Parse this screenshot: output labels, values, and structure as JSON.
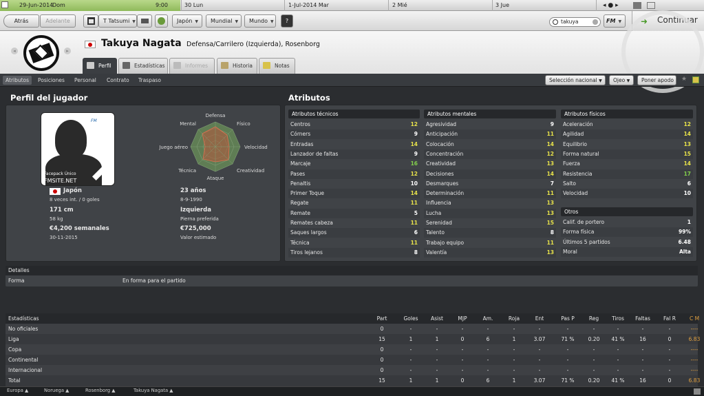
{
  "date_bar": {
    "current_date": "29-Jun-2014",
    "current_day": "Dom",
    "time": "9:00",
    "days": [
      "30 Lun",
      "1-Jul-2014 Mar",
      "2 Mié",
      "3 Jue"
    ]
  },
  "toolbar": {
    "back": "Atrás",
    "forward": "Adelante",
    "manager": "T Tatsumi",
    "nation": "Japón",
    "world": "Mundial",
    "mundo": "Mundo",
    "help": "?",
    "search_value": "takuya",
    "fm_menu": "FM",
    "continue": "Continuar"
  },
  "player": {
    "name": "Takuya Nagata",
    "position_club": "Defensa/Carrilero (Izquierda), Rosenborg",
    "flag_color": "#cc0000"
  },
  "tabs": [
    {
      "label": "Perfil"
    },
    {
      "label": "Estadísticas"
    },
    {
      "label": "Informes"
    },
    {
      "label": "Historia"
    },
    {
      "label": "Notas"
    }
  ],
  "subnav": {
    "items": [
      "Atributos",
      "Posiciones",
      "Personal",
      "Contrato",
      "Traspaso"
    ],
    "national_selection": "Selección nacional",
    "scout": "Ojeo",
    "loan": "Poner apodo"
  },
  "profile": {
    "title": "Perfil del jugador",
    "photo_caption1": "Facepack Único",
    "photo_caption2": "FMSITE.NET",
    "nationality": "Japón",
    "caps": "8 veces int. / 0 goles",
    "age": "23 años",
    "dob": "8-9-1990",
    "height": "171 cm",
    "weight": "58 kg",
    "foot": "Izquierda",
    "foot_label": "Pierna preferida",
    "wage": "€4,200 semanales",
    "contract_end": "30-11-2015",
    "value": "€725,000",
    "value_label": "Valor estimado",
    "radar_labels": {
      "defensa": "Defensa",
      "fisico": "Físico",
      "velocidad": "Velocidad",
      "creatividad": "Creatividad",
      "ataque": "Ataque",
      "tecnica": "Técnica",
      "juego_aereo": "Juego aéreo",
      "mental": "Mental"
    }
  },
  "attributes": {
    "title": "Atributos",
    "technical": {
      "header": "Atributos técnicos",
      "rows": [
        [
          "Centros",
          "12"
        ],
        [
          "Córners",
          "9"
        ],
        [
          "Entradas",
          "14"
        ],
        [
          "Lanzador de faltas",
          "9"
        ],
        [
          "Marcaje",
          "16"
        ],
        [
          "Pases",
          "12"
        ],
        [
          "Penaltis",
          "10"
        ],
        [
          "Primer Toque",
          "14"
        ],
        [
          "Regate",
          "11"
        ],
        [
          "Remate",
          "5"
        ],
        [
          "Remates cabeza",
          "11"
        ],
        [
          "Saques largos",
          "6"
        ],
        [
          "Técnica",
          "11"
        ],
        [
          "Tiros lejanos",
          "8"
        ]
      ]
    },
    "mental": {
      "header": "Atributos mentales",
      "rows": [
        [
          "Agresividad",
          "9"
        ],
        [
          "Anticipación",
          "11"
        ],
        [
          "Colocación",
          "14"
        ],
        [
          "Concentración",
          "12"
        ],
        [
          "Creatividad",
          "13"
        ],
        [
          "Decisiones",
          "14"
        ],
        [
          "Desmarques",
          "7"
        ],
        [
          "Determinación",
          "11"
        ],
        [
          "Influencia",
          "13"
        ],
        [
          "Lucha",
          "13"
        ],
        [
          "Serenidad",
          "15"
        ],
        [
          "Talento",
          "8"
        ],
        [
          "Trabajo equipo",
          "11"
        ],
        [
          "Valentía",
          "13"
        ]
      ]
    },
    "physical": {
      "header": "Atributos físicos",
      "rows": [
        [
          "Aceleración",
          "12"
        ],
        [
          "Agilidad",
          "14"
        ],
        [
          "Equilibrio",
          "13"
        ],
        [
          "Forma natural",
          "15"
        ],
        [
          "Fuerza",
          "14"
        ],
        [
          "Resistencia",
          "17"
        ],
        [
          "Salto",
          "6"
        ],
        [
          "Velocidad",
          "10"
        ]
      ]
    },
    "other": {
      "header": "Otros",
      "rows": [
        [
          "Calif. de portero",
          "1"
        ],
        [
          "Forma física",
          "99%"
        ],
        [
          "Últimos 5 partidos",
          "6.48"
        ],
        [
          "Moral",
          "Alta"
        ]
      ]
    }
  },
  "details": {
    "header": "Detalles",
    "label": "Forma",
    "value": "En forma para el partido"
  },
  "stats": {
    "columns": [
      "Estadísticas",
      "Part",
      "Goles",
      "Asist",
      "MJP",
      "Am.",
      "Roja",
      "Ent",
      "Pas P",
      "Reg",
      "Tiros",
      "Faltas",
      "Fal R",
      "C M"
    ],
    "rows": [
      [
        "No oficiales",
        "0",
        "-",
        "-",
        "-",
        "-",
        "-",
        "-",
        "-",
        "-",
        "-",
        "-",
        "-",
        "----"
      ],
      [
        "Liga",
        "15",
        "1",
        "1",
        "0",
        "6",
        "1",
        "3.07",
        "71 %",
        "0.20",
        "41 %",
        "16",
        "0",
        "6.83"
      ],
      [
        "Copa",
        "0",
        "-",
        "-",
        "-",
        "-",
        "-",
        "-",
        "-",
        "-",
        "-",
        "-",
        "-",
        "----"
      ],
      [
        "Continental",
        "0",
        "-",
        "-",
        "-",
        "-",
        "-",
        "-",
        "-",
        "-",
        "-",
        "-",
        "-",
        "----"
      ],
      [
        "Internacional",
        "0",
        "-",
        "-",
        "-",
        "-",
        "-",
        "-",
        "-",
        "-",
        "-",
        "-",
        "-",
        "----"
      ],
      [
        "Total",
        "15",
        "1",
        "1",
        "0",
        "6",
        "1",
        "3.07",
        "71 %",
        "0.20",
        "41 %",
        "16",
        "0",
        "6.83"
      ]
    ]
  },
  "breadcrumb": [
    "Europa",
    "Noruega",
    "Rosenborg",
    "Takuya Nagata"
  ]
}
